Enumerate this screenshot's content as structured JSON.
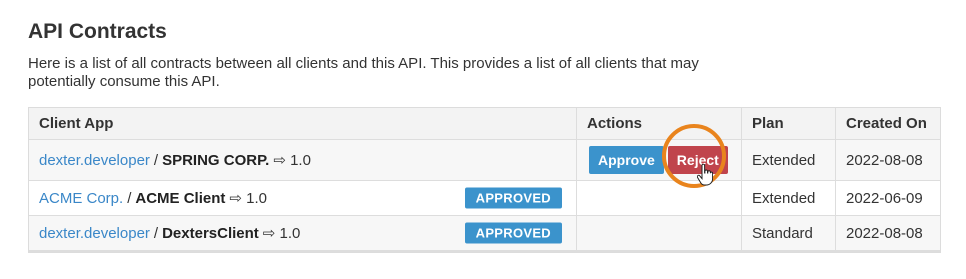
{
  "page": {
    "title": "API Contracts",
    "description": "Here is a list of all contracts between all clients and this API. This provides a list of all clients that may potentially consume this API."
  },
  "table": {
    "headers": [
      "Client App",
      "Actions",
      "Plan",
      "Created On"
    ],
    "rows": [
      {
        "org": "dexter.developer",
        "client": "SPRING CORP.",
        "version": "⇨ 1.0",
        "status": "",
        "approve": "Approve",
        "reject": "Reject",
        "plan": "Extended",
        "created": "2022-08-08"
      },
      {
        "org": "ACME Corp.",
        "client": "ACME Client",
        "version": "⇨ 1.0",
        "status": "APPROVED",
        "plan": "Extended",
        "created": "2022-06-09"
      },
      {
        "org": "dexter.developer",
        "client": "DextersClient",
        "version": "⇨ 1.0",
        "status": "APPROVED",
        "plan": "Standard",
        "created": "2022-08-08"
      }
    ]
  },
  "colors": {
    "accent": "#3b93cc",
    "danger": "#c0444c",
    "highlight": "#e9841d"
  },
  "icons": {
    "cursor": "hand-pointer-icon"
  }
}
